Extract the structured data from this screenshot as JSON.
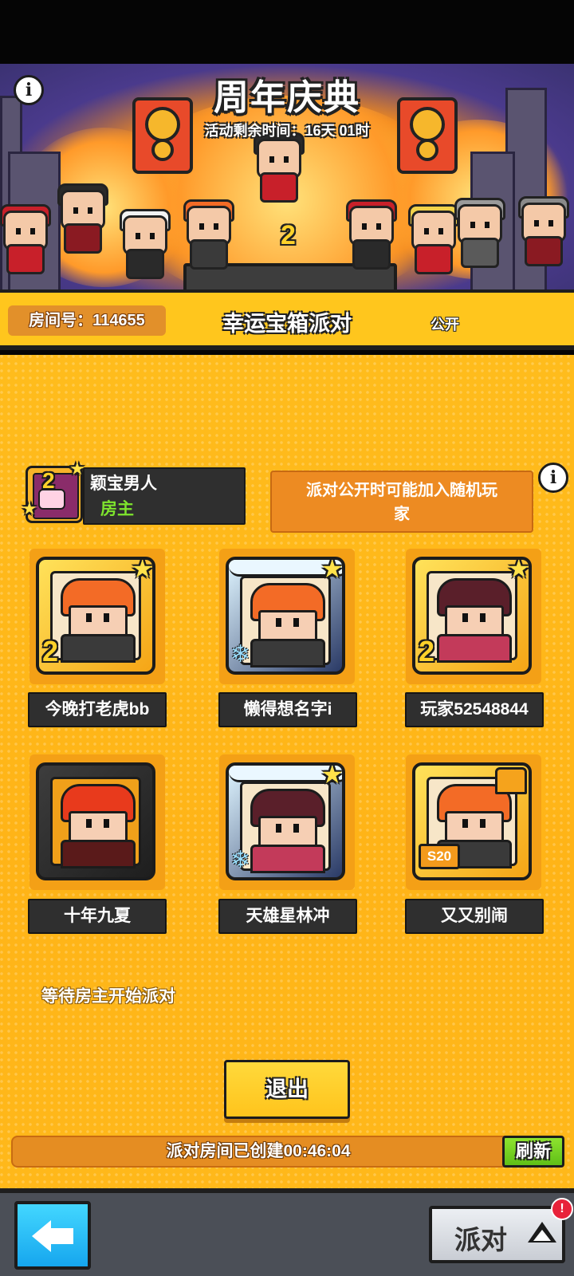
{
  "event": {
    "title": "周年庆典",
    "remaining_time": "活动剩余时间：16天 01时",
    "stage_number": "2"
  },
  "room": {
    "room_number": "房间号：114655",
    "party_name": "幸运宝箱派对",
    "visibility": "公开"
  },
  "host": {
    "name": "颖宝男人",
    "role": "房主",
    "badge_level": "2"
  },
  "notice": "派对公开时可能加入随机玩家",
  "players": [
    {
      "name": "今晚打老虎bb",
      "frame": "gold",
      "level": "2",
      "hair_color": "#f36b26",
      "coat_color": "#3a3a3a"
    },
    {
      "name": "懒得想名字i",
      "frame": "ice",
      "level": "",
      "hair_color": "#f36b26",
      "coat_color": "#3a3a3a"
    },
    {
      "name": "玩家52548844",
      "frame": "gold",
      "level": "2",
      "hair_color": "#5a1f2a",
      "coat_color": "#c33a5a"
    },
    {
      "name": "十年九夏",
      "frame": "dark",
      "level": "",
      "hair_color": "#e83a1c",
      "coat_color": "#5a1a1a"
    },
    {
      "name": "天雄星林冲",
      "frame": "ice",
      "level": "",
      "hair_color": "#5a1f2a",
      "coat_color": "#c33a5a"
    },
    {
      "name": "又又别闹",
      "frame": "gold",
      "level": "S20",
      "hair_color": "#f36b26",
      "coat_color": "#3a3a3a"
    }
  ],
  "status": {
    "waiting": "等待房主开始派对",
    "created": "派对房间已创建00:46:04"
  },
  "buttons": {
    "exit": "退出",
    "refresh": "刷新",
    "party": "派对",
    "alert": "!"
  },
  "colors": {
    "panel_yellow": "#ffb417",
    "host_role_green": "#7ee42d",
    "refresh_green": "#5fbf17",
    "back_blue": "#16a6ee"
  }
}
